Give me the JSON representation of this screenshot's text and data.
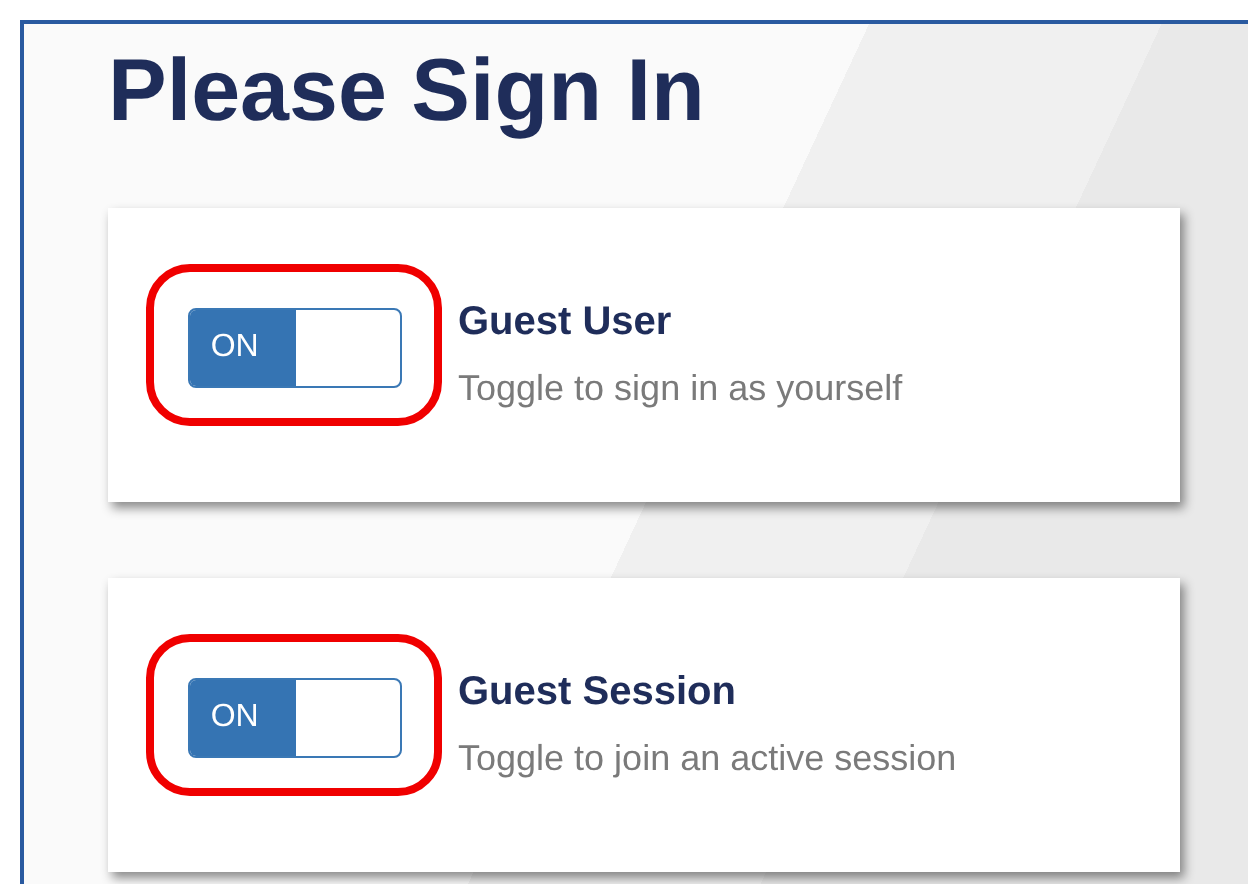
{
  "title": "Please Sign In",
  "options": [
    {
      "toggle_label": "ON",
      "on": true,
      "highlighted": true,
      "title": "Guest User",
      "description": "Toggle to sign in as yourself"
    },
    {
      "toggle_label": "ON",
      "on": true,
      "highlighted": true,
      "title": "Guest Session",
      "description": "Toggle to join an active session"
    }
  ]
}
